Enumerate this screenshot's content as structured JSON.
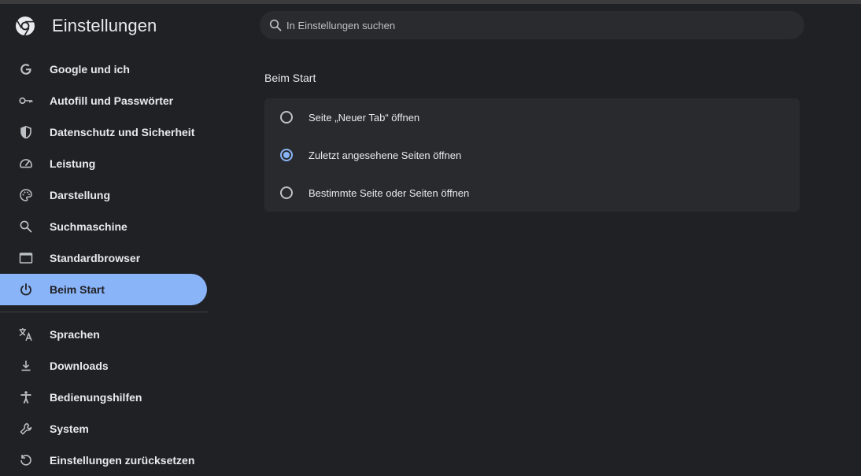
{
  "header": {
    "title": "Einstellungen",
    "logo_icon": "chrome-logo-icon"
  },
  "search": {
    "placeholder": "In Einstellungen suchen",
    "value": ""
  },
  "sidebar": {
    "items": [
      {
        "label": "Google und ich",
        "icon": "google-g-icon",
        "active": false
      },
      {
        "label": "Autofill und Passwörter",
        "icon": "key-icon",
        "active": false
      },
      {
        "label": "Datenschutz und Sicherheit",
        "icon": "shield-icon",
        "active": false
      },
      {
        "label": "Leistung",
        "icon": "speedometer-icon",
        "active": false
      },
      {
        "label": "Darstellung",
        "icon": "palette-icon",
        "active": false
      },
      {
        "label": "Suchmaschine",
        "icon": "search-icon",
        "active": false
      },
      {
        "label": "Standardbrowser",
        "icon": "browser-window-icon",
        "active": false
      },
      {
        "label": "Beim Start",
        "icon": "power-icon",
        "active": true
      }
    ],
    "items_after_divider": [
      {
        "label": "Sprachen",
        "icon": "translate-icon"
      },
      {
        "label": "Downloads",
        "icon": "download-icon"
      },
      {
        "label": "Bedienungshilfen",
        "icon": "accessibility-icon"
      },
      {
        "label": "System",
        "icon": "wrench-icon"
      },
      {
        "label": "Einstellungen zurücksetzen",
        "icon": "reset-icon"
      }
    ]
  },
  "main": {
    "section_title": "Beim Start",
    "options": [
      {
        "label": "Seite „Neuer Tab“ öffnen",
        "selected": false
      },
      {
        "label": "Zuletzt angesehene Seiten öffnen",
        "selected": true
      },
      {
        "label": "Bestimmte Seite oder Seiten öffnen",
        "selected": false
      }
    ]
  },
  "colors": {
    "background": "#202124",
    "accent": "#8ab4f8",
    "card": "#292a2d",
    "text": "#e8eaed"
  }
}
